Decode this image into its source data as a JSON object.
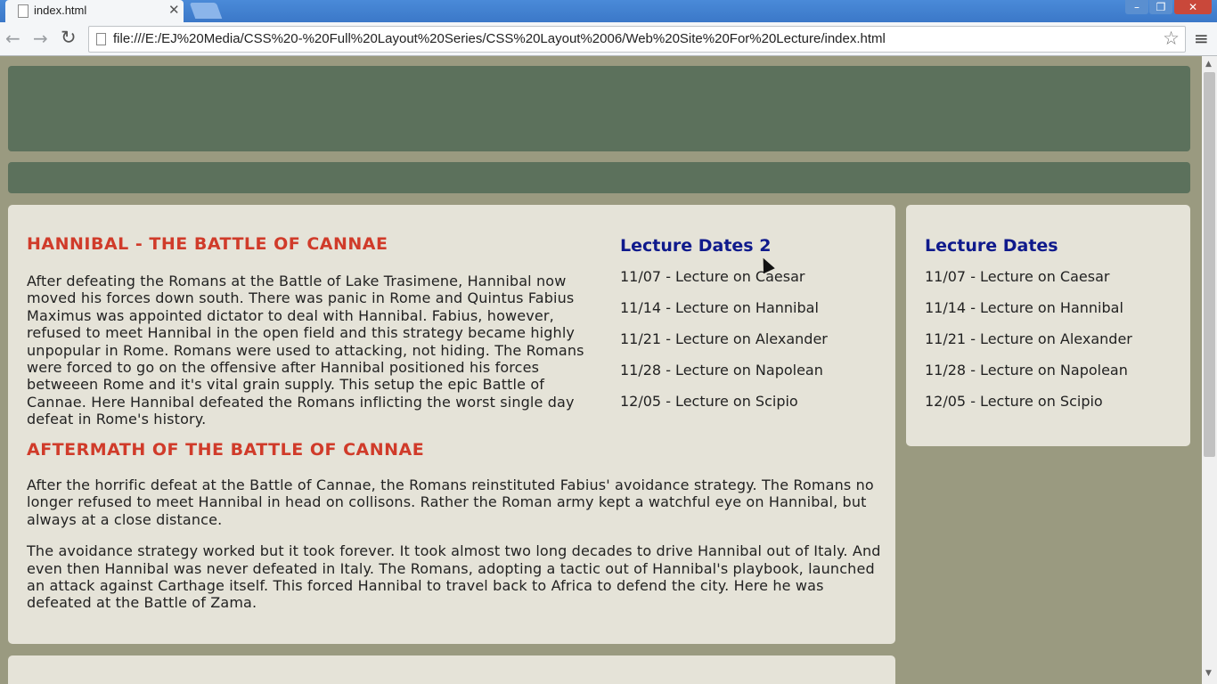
{
  "browser": {
    "tab_title": "index.html",
    "tab_close": "✕",
    "url": "file:///E:/EJ%20Media/CSS%20-%20Full%20Layout%20Series/CSS%20Layout%2006/Web%20Site%20For%20Lecture/index.html",
    "buttons": {
      "back": "←",
      "forward": "→",
      "reload": "↻",
      "star": "☆",
      "menu": "≡",
      "minimize": "–",
      "maximize": "❐",
      "close": "✕"
    }
  },
  "main": {
    "heading1": "HANNIBAL - THE BATTLE OF CANNAE",
    "paragraph1": "After defeating the Romans at the Battle of Lake Trasimene, Hannibal now moved his forces down south. There was panic in Rome and Quintus Fabius Maximus was appointed dictator to deal with Hannibal. Fabius, however, refused to meet Hannibal in the open field and this strategy became highly unpopular in Rome. Romans were used to attacking, not hiding. The Romans were forced to go on the offensive after Hannibal positioned his forces betweeen Rome and it's vital grain supply. This setup the epic Battle of Cannae. Here Hannibal defeated the Romans inflicting the worst single day defeat in Rome's history.",
    "heading2": "AFTERMATH OF THE BATTLE OF CANNAE",
    "paragraph2": "After the horrific defeat at the Battle of Cannae, the Romans reinstituted Fabius' avoidance strategy. The Romans no longer refused to meet Hannibal in head on collisons. Rather the Roman army kept a watchful eye on Hannibal, but always at a close distance.",
    "paragraph3": "The avoidance strategy worked but it took forever. It took almost two long decades to drive Hannibal out of Italy. And even then Hannibal was never defeated in Italy. The Romans, adopting a tactic out of Hannibal's playbook, launched an attack against Carthage itself. This forced Hannibal to travel back to Africa to defend the city. Here he was defeated at the Battle of Zama."
  },
  "inner_lectures": {
    "title": "Lecture Dates 2",
    "items": [
      "11/07 - Lecture on Caesar",
      "11/14 - Lecture on Hannibal",
      "11/21 - Lecture on Alexander",
      "11/28 - Lecture on Napolean",
      "12/05 - Lecture on Scipio"
    ]
  },
  "side_lectures": {
    "title": "Lecture Dates",
    "items": [
      "11/07 - Lecture on Caesar",
      "11/14 - Lecture on Hannibal",
      "11/21 - Lecture on Alexander",
      "11/28 - Lecture on Napolean",
      "12/05 - Lecture on Scipio"
    ]
  },
  "colors": {
    "header": "#5c715c",
    "page_bg": "#9a9a80",
    "panel": "#e5e3d8",
    "heading_red": "#d03b2a",
    "heading_blue": "#0f1a8c"
  }
}
